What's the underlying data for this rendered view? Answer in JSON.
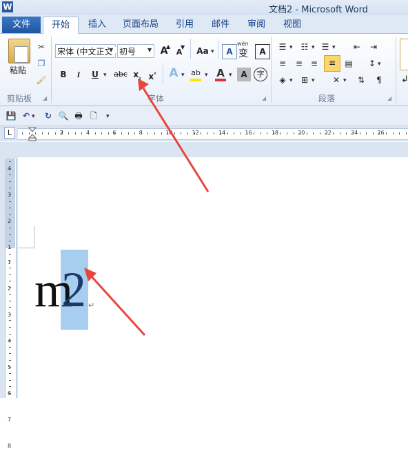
{
  "window": {
    "title": "文档2 - Microsoft Word",
    "app_icon": "W"
  },
  "tabs": {
    "file": "文件",
    "home": "开始",
    "insert": "插入",
    "layout": "页面布局",
    "references": "引用",
    "mailings": "邮件",
    "review": "审阅",
    "view": "视图"
  },
  "clipboard": {
    "paste": "粘贴",
    "group": "剪贴板"
  },
  "font": {
    "name": "宋体 (中文正文",
    "size": "初号",
    "grow": "A",
    "shrink": "A",
    "case": "Aa",
    "bold": "B",
    "italic": "I",
    "underline": "U",
    "strike": "abc",
    "subscript": "x",
    "sub_mark": "₂",
    "superscript": "x",
    "sup_mark": "²",
    "effects": "A",
    "highlight": "ab",
    "color": "A",
    "shading": "A",
    "enclose": "字",
    "clear": "A",
    "phonetic": "wén",
    "phonetic_char": "变",
    "border_char": "A",
    "group": "字体"
  },
  "paragraph": {
    "group": "段落"
  },
  "ruler": {
    "corner": "L",
    "h_numbers": [
      "2",
      "2",
      "4",
      "6",
      "8",
      "10",
      "12",
      "14",
      "16",
      "18",
      "20",
      "22",
      "24",
      "26"
    ],
    "v_numbers": [
      "4",
      "3",
      "2",
      "1",
      "1",
      "2",
      "3",
      "4",
      "5",
      "6",
      "7",
      "8"
    ]
  },
  "document": {
    "char_m": "m",
    "char_2": "2",
    "para_mark": "↵"
  },
  "colors": {
    "accent": "#2b579a",
    "highlight_selection": "#a7cdef",
    "arrow": "#e8453c",
    "font_color": "#e03030",
    "highlight_color": "#ffe600"
  }
}
